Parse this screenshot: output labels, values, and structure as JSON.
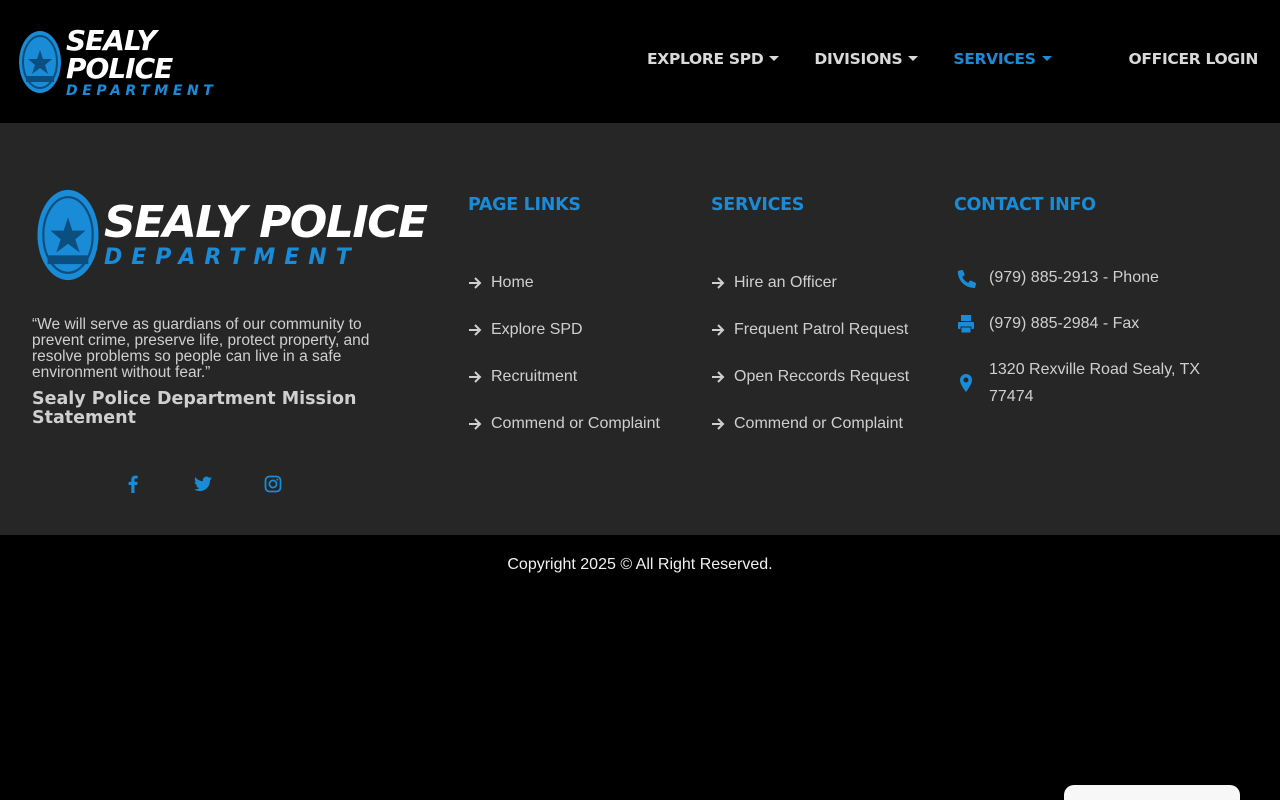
{
  "header": {
    "logo": {
      "line1": "SEALY POLICE",
      "line2": "DEPARTMENT"
    },
    "nav": [
      {
        "label": "EXPLORE SPD",
        "active": false
      },
      {
        "label": "DIVISIONS",
        "active": false
      },
      {
        "label": "SERVICES",
        "active": true
      }
    ],
    "officer_login": "OFFICER LOGIN"
  },
  "footer": {
    "logo": {
      "line1": "SEALY POLICE",
      "line2": "DEPARTMENT"
    },
    "mission_quote": "“We will serve as guardians of our community to prevent crime, preserve life, protect property, and resolve problems so people can live in a safe environment without fear.”",
    "mission_title": "Sealy Police Department Mission Statement",
    "social": [
      "facebook-icon",
      "twitter-icon",
      "instagram-icon"
    ],
    "page_links": {
      "title": "PAGE LINKS",
      "items": [
        "Home",
        "Explore SPD",
        "Recruitment",
        "Commend or Complaint"
      ]
    },
    "services": {
      "title": "SERVICES",
      "items": [
        "Hire an Officer",
        "Frequent Patrol Request",
        "Open Reccords Request",
        "Commend or Complaint"
      ]
    },
    "contact": {
      "title": "CONTACT INFO",
      "phone": "(979) 885-2913 - Phone",
      "fax": "(979) 885-2984 - Fax",
      "address": "1320 Rexville Road Sealy, TX 77474"
    }
  },
  "copyright": "Copyright 2025 © All Right Reserved.",
  "colors": {
    "accent": "#1a8bd6",
    "footer_bg": "#262626",
    "header_bg": "#000000"
  }
}
